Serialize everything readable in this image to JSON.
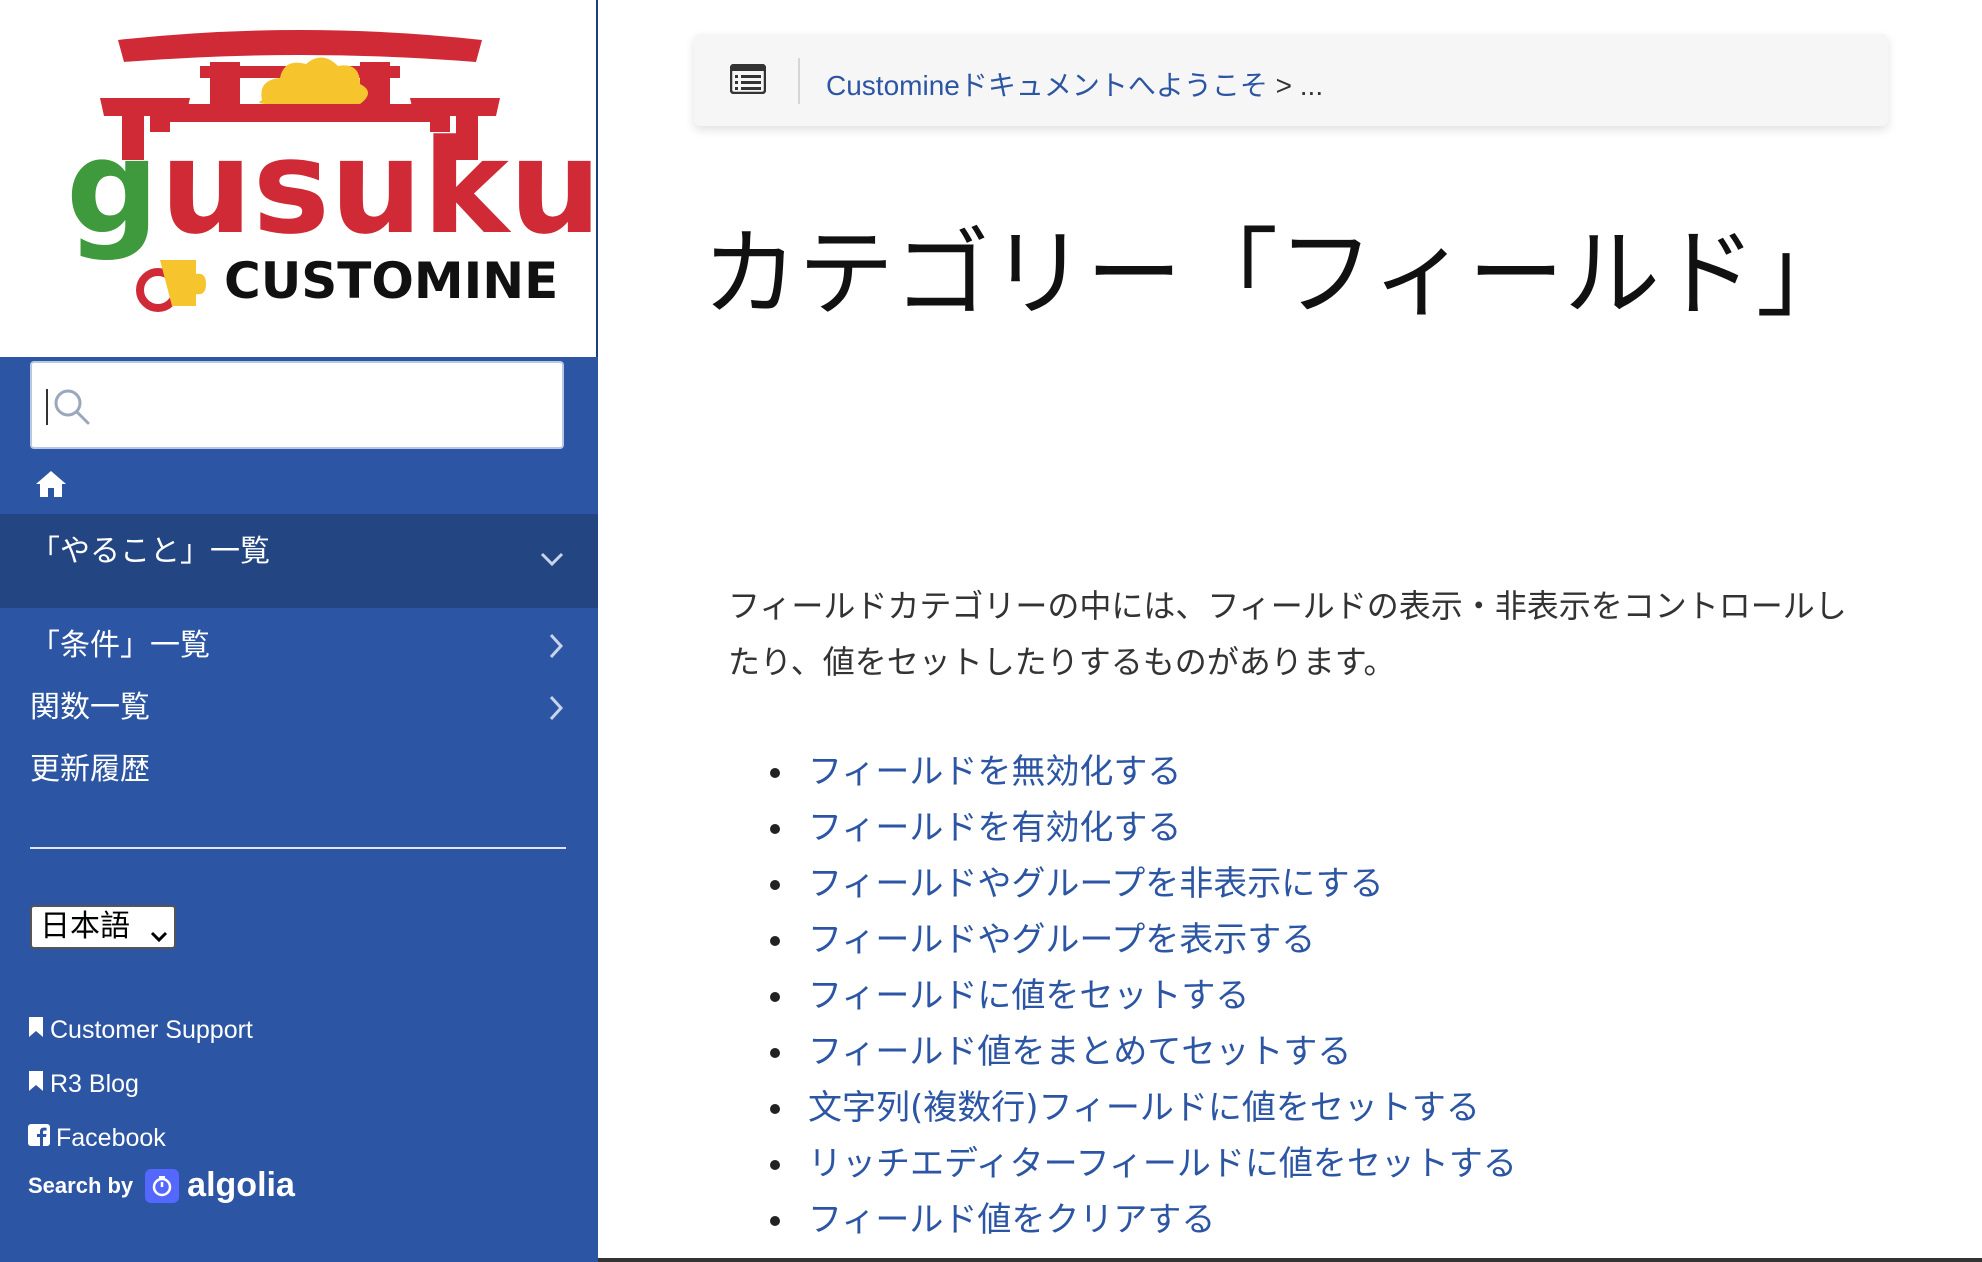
{
  "sidebar": {
    "logo": {
      "wordmark": "gusuku",
      "product": "CUSTOMINE"
    },
    "search": {
      "placeholder": ""
    },
    "home_icon": "home-icon",
    "nav": [
      {
        "label": "「やること」一覧",
        "icon": "chevron-down-icon",
        "active": true
      },
      {
        "label": "「条件」一覧",
        "icon": "chevron-right-icon"
      },
      {
        "label": "関数一覧",
        "icon": "chevron-right-icon"
      },
      {
        "label": "更新履歴"
      }
    ],
    "language": {
      "selected": "日本語"
    },
    "links": [
      {
        "label": "Customer Support",
        "icon": "bookmark-icon"
      },
      {
        "label": "R3 Blog",
        "icon": "bookmark-icon"
      },
      {
        "label": "Facebook",
        "icon": "facebook-icon"
      }
    ],
    "search_by": {
      "prefix": "Search by",
      "brand": "algolia"
    }
  },
  "main": {
    "breadcrumb": {
      "link": "Customineドキュメントへようこそ",
      "separator": " > ",
      "current": "..."
    },
    "title": "カテゴリー「フィールド」",
    "intro": "フィールドカテゴリーの中には、フィールドの表示・非表示をコントロールしたり、値をセットしたりするものがあります。",
    "links": [
      "フィールドを無効化する",
      "フィールドを有効化する",
      "フィールドやグループを非表示にする",
      "フィールドやグループを表示する",
      "フィールドに値をセットする",
      "フィールド値をまとめてセットする",
      "文字列(複数行)フィールドに値をセットする",
      "リッチエディターフィールドに値をセットする",
      "フィールド値をクリアする"
    ]
  },
  "colors": {
    "sidebar_bg": "#2c55a4",
    "sidebar_active_bg": "#234683",
    "link": "#2c55a4",
    "logo_red": "#d02a36",
    "logo_green": "#3e9a3c",
    "logo_yellow": "#f6c42c"
  }
}
